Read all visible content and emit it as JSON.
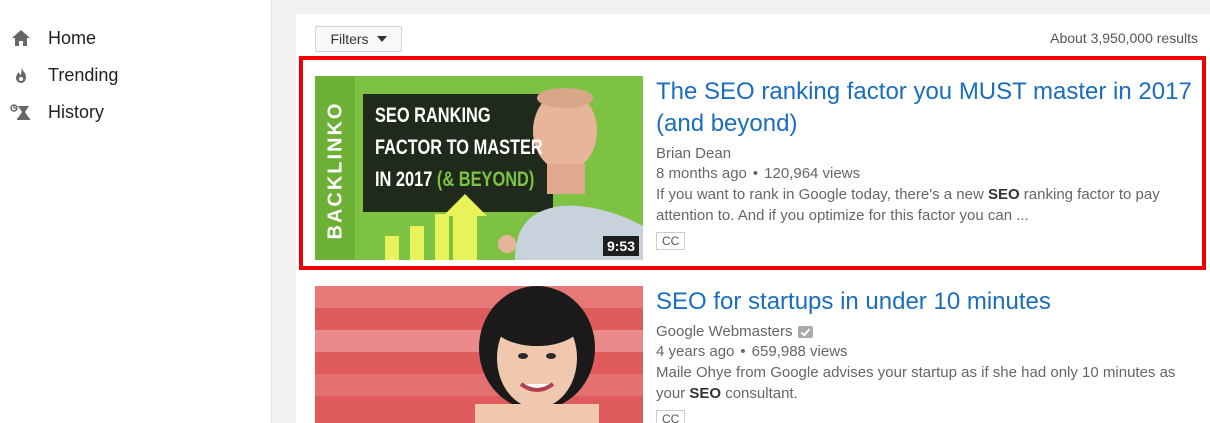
{
  "sidebar": {
    "items": [
      {
        "label": "Home",
        "icon": "home-icon"
      },
      {
        "label": "Trending",
        "icon": "flame-icon"
      },
      {
        "label": "History",
        "icon": "history-icon"
      }
    ]
  },
  "toolbar": {
    "filters_label": "Filters",
    "results_count": "About 3,950,000 results"
  },
  "videos": [
    {
      "title": "The SEO ranking factor you MUST master in 2017 (and beyond)",
      "channel": "Brian Dean",
      "age": "8 months ago",
      "views": "120,964 views",
      "desc_pre": "If you want to rank in Google today, there's a new ",
      "desc_bold": "SEO",
      "desc_post": " ranking factor to pay attention to. And if you optimize for this factor you can ...",
      "badge": "CC",
      "duration": "9:53",
      "thumb_text": {
        "brand": "BACKLINKO",
        "line1": "SEO RANKING",
        "line2": "FACTOR TO MASTER",
        "line3": "IN 2017",
        "line3_accent": "(& BEYOND)"
      }
    },
    {
      "title": "SEO for startups in under 10 minutes",
      "channel": "Google Webmasters",
      "age": "4 years ago",
      "views": "659,988 views",
      "desc_pre": "Maile Ohye from Google advises your startup as if she had only 10 minutes as your ",
      "desc_bold": "SEO",
      "desc_post": " consultant.",
      "badge": "CC"
    }
  ],
  "colors": {
    "link": "#1a6dbf",
    "highlight": "#ee0000",
    "thumb_green": "#7dc242"
  }
}
